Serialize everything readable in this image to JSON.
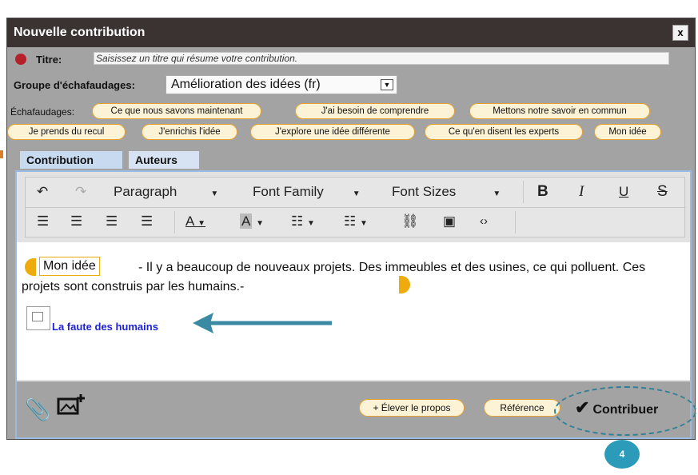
{
  "dialog": {
    "title": "Nouvelle contribution",
    "close_label": "x"
  },
  "titre": {
    "label": "Titre:",
    "placeholder": "Saisissez un titre qui résume votre contribution."
  },
  "groupe": {
    "label": "Groupe d'échafaudages:",
    "selected": "Amélioration des idées (fr)"
  },
  "echafaudages": {
    "label": "Échafaudages:",
    "items": [
      "Ce que nous savons maintenant",
      "J'ai besoin de comprendre",
      "Mettons notre savoir en commun",
      "Je prends du recul",
      "J'enrichis l'idée",
      "J'explore une idée différente",
      "Ce qu'en disent les experts",
      "Mon idée"
    ]
  },
  "tabs": [
    "Contribution",
    "Auteurs"
  ],
  "toolbar": {
    "paragraph": "Paragraph",
    "font_family": "Font Family",
    "font_sizes": "Font Sizes",
    "bold": "B",
    "italic": "I",
    "underline": "U",
    "strike": "S"
  },
  "editor": {
    "tag_label": "Mon idée",
    "text": "- Il y a beaucoup de nouveaux projets. Des immeubles et des usines, ce qui polluent. Ces projets sont construis par les humains.-",
    "link_text": "La faute des humains"
  },
  "bottom": {
    "elever": "+ Élever le propos",
    "reference": "Référence",
    "contribuer": "Contribuer"
  },
  "callout": {
    "number": "4"
  },
  "colors": {
    "titlebar": "#3b3331",
    "dialog_bg": "#a3a3a3",
    "pill_border": "#e5a233",
    "tag_yellow": "#eeab0c",
    "link_blue": "#1d22d9",
    "callout_teal": "#2c9bb9"
  }
}
